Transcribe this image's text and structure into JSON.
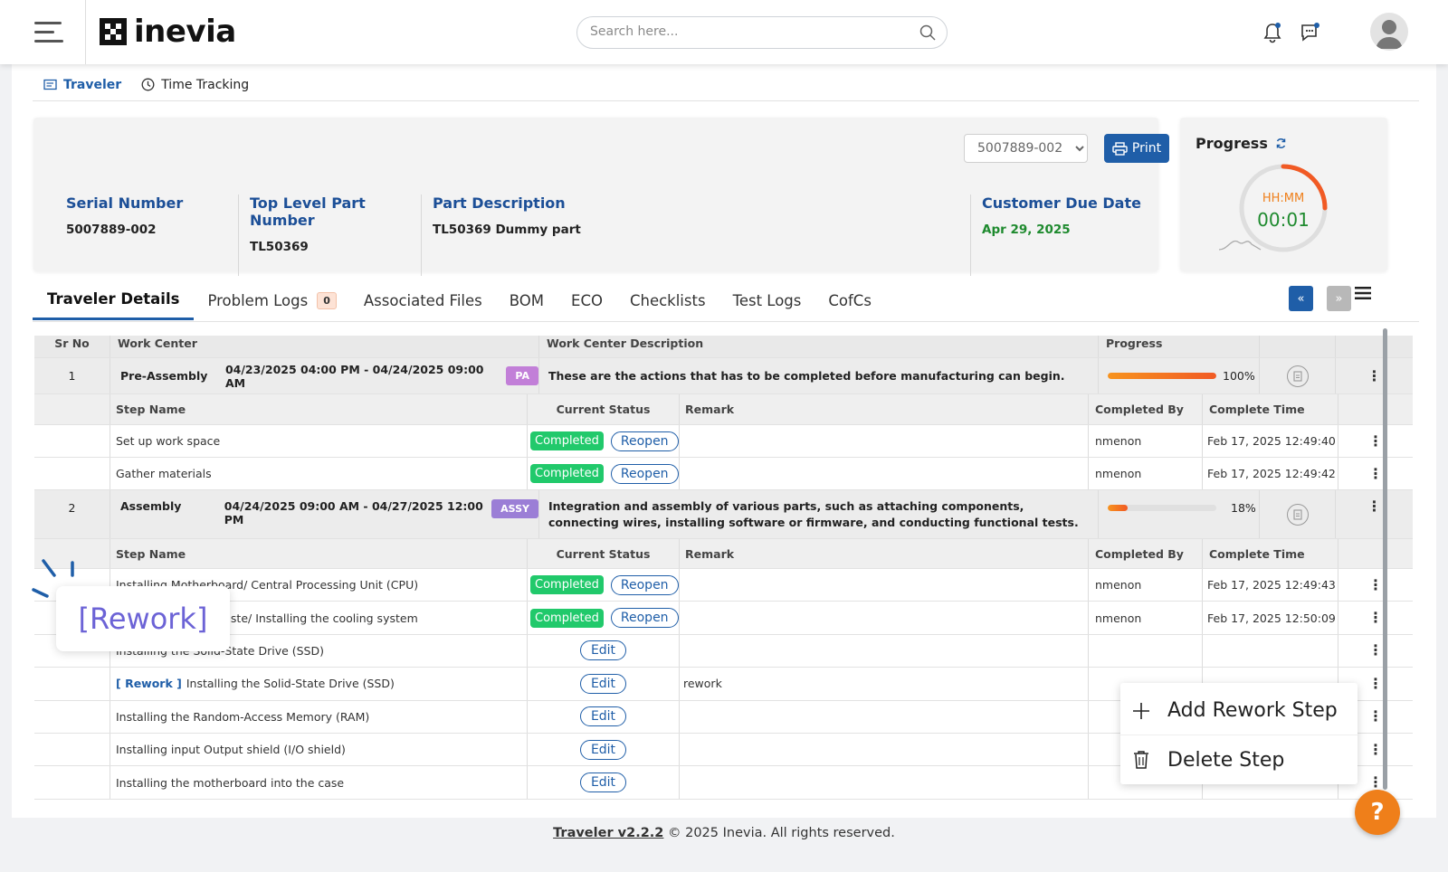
{
  "brand": {
    "name": "inevia"
  },
  "search": {
    "placeholder": "Search here..."
  },
  "subnav": {
    "traveler": "Traveler",
    "time_tracking": "Time Tracking"
  },
  "header": {
    "serial_select_value": "5007889-002",
    "print_label": "Print",
    "fields": [
      {
        "label": "Serial Number",
        "value": "5007889-002"
      },
      {
        "label": "Top Level Part Number",
        "value": "TL50369"
      },
      {
        "label": "Part Description",
        "value": "TL50369 Dummy part"
      },
      {
        "label": "Customer Due Date",
        "value": "Apr 29, 2025"
      }
    ]
  },
  "progress_widget": {
    "title": "Progress",
    "label": "HH:MM",
    "time": "00:01"
  },
  "tabs": [
    {
      "label": "Traveler Details",
      "active": true
    },
    {
      "label": "Problem Logs",
      "badge": "0"
    },
    {
      "label": "Associated Files"
    },
    {
      "label": "BOM"
    },
    {
      "label": "ECO"
    },
    {
      "label": "Checklists"
    },
    {
      "label": "Test Logs"
    },
    {
      "label": "CofCs"
    }
  ],
  "table": {
    "headers": {
      "sr_no": "Sr No",
      "work_center": "Work Center",
      "description": "Work Center Description",
      "progress": "Progress"
    },
    "step_headers": {
      "step_name": "Step Name",
      "status": "Current Status",
      "remark": "Remark",
      "completed_by": "Completed By",
      "complete_time": "Complete Time"
    },
    "labels": {
      "completed": "Completed",
      "reopen": "Reopen",
      "edit": "Edit",
      "rework_tag": "[ Rework ]"
    },
    "centers": [
      {
        "sr": "1",
        "name": "Pre-Assembly",
        "dates": "04/23/2025 04:00 PM - 04/24/2025 09:00 AM",
        "tag": "PA",
        "tag_color": "#c27fd8",
        "description": "These are the actions that has to be completed before manufacturing can begin.",
        "progress_pct": 100,
        "progress_text": "100%",
        "steps": [
          {
            "name": "Set up work space",
            "status": "completed",
            "remark": "",
            "by": "nmenon",
            "time": "Feb 17, 2025 12:49:40"
          },
          {
            "name": "Gather materials",
            "status": "completed",
            "remark": "",
            "by": "nmenon",
            "time": "Feb 17, 2025 12:49:42"
          }
        ]
      },
      {
        "sr": "2",
        "name": "Assembly",
        "dates": "04/24/2025 09:00 AM - 04/27/2025 12:00 PM",
        "tag": "ASSY",
        "tag_color": "#9b7ed6",
        "description": "Integration and assembly of various parts, such as attaching components, connecting wires, installing software or firmware, and conducting functional tests.",
        "progress_pct": 18,
        "progress_text": "18%",
        "steps": [
          {
            "name": "Installing Motherboard/ Central Processing Unit (CPU)",
            "status": "completed",
            "remark": "",
            "by": "nmenon",
            "time": "Feb 17, 2025 12:49:43"
          },
          {
            "name": "Applying thermal paste/ Installing the cooling system",
            "status": "completed",
            "remark": "",
            "by": "nmenon",
            "time": "Feb 17, 2025 12:50:09"
          },
          {
            "name": "Installing the Solid-State Drive (SSD)",
            "status": "edit",
            "remark": "",
            "by": "",
            "time": ""
          },
          {
            "name": "Installing the Solid-State Drive (SSD)",
            "rework": true,
            "status": "edit",
            "remark": "rework",
            "by": "",
            "time": ""
          },
          {
            "name": "Installing the Random-Access Memory (RAM)",
            "status": "edit",
            "remark": "",
            "by": "",
            "time": ""
          },
          {
            "name": "Installing input Output shield (I/O shield)",
            "status": "edit",
            "remark": "",
            "by": "",
            "time": ""
          },
          {
            "name": "Installing the motherboard into the case",
            "status": "edit",
            "remark": "",
            "by": "",
            "time": ""
          }
        ]
      }
    ]
  },
  "context_menu": {
    "add": "Add Rework Step",
    "delete": "Delete Step"
  },
  "callout": {
    "text": "[Rework]"
  },
  "footer": {
    "version": "Traveler v2.2.2",
    "copyright": " © 2025 Inevia. All rights reserved."
  },
  "help": {
    "label": "?"
  },
  "colors": {
    "primary": "#1f5ea8",
    "completed": "#21c96b",
    "accent": "#ef7f1a",
    "due": "#1e8a2e"
  }
}
